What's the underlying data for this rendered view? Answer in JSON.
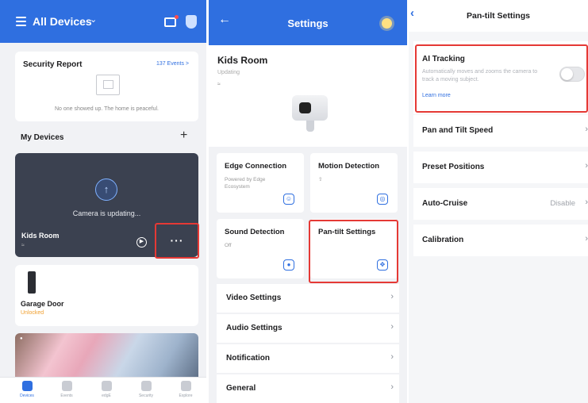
{
  "home": {
    "title": "All Devices",
    "security_report": {
      "title": "Security Report",
      "events": "137 Events >",
      "empty_text": "No one showed up. The home is peaceful."
    },
    "my_devices_label": "My Devices",
    "add_label": "+",
    "camera_card": {
      "status": "Camera is updating...",
      "name": "Kids Room",
      "more_label": "···"
    },
    "garage_card": {
      "name": "Garage Door",
      "status": "Unlocked"
    },
    "tabs": [
      {
        "label": "Devices"
      },
      {
        "label": "Events"
      },
      {
        "label": "edgE"
      },
      {
        "label": "Security"
      },
      {
        "label": "Explore"
      }
    ]
  },
  "settings": {
    "title": "Settings",
    "device": {
      "name": "Kids Room",
      "status": "Updating"
    },
    "tiles": [
      {
        "title": "Edge Connection",
        "subtitle": "Powered by Edge Ecosystem"
      },
      {
        "title": "Motion Detection",
        "subtitle": ""
      },
      {
        "title": "Sound Detection",
        "subtitle": "Off"
      },
      {
        "title": "Pan-tilt Settings",
        "subtitle": ""
      }
    ],
    "rows": [
      {
        "label": "Video Settings"
      },
      {
        "label": "Audio Settings"
      },
      {
        "label": "Notification"
      },
      {
        "label": "General"
      }
    ]
  },
  "pantilt": {
    "title": "Pan-tilt Settings",
    "ai_tracking": {
      "title": "AI Tracking",
      "description": "Automatically moves and zooms the camera to track a moving subject.",
      "learn_more": "Learn more",
      "enabled": false
    },
    "rows": [
      {
        "label": "Pan and Tilt Speed",
        "value": ""
      },
      {
        "label": "Preset Positions",
        "value": ""
      },
      {
        "label": "Auto-Cruise",
        "value": "Disable"
      },
      {
        "label": "Calibration",
        "value": ""
      }
    ]
  },
  "colors": {
    "accent": "#2f6fe0",
    "highlight": "#e53935",
    "warning": "#f0a030"
  }
}
